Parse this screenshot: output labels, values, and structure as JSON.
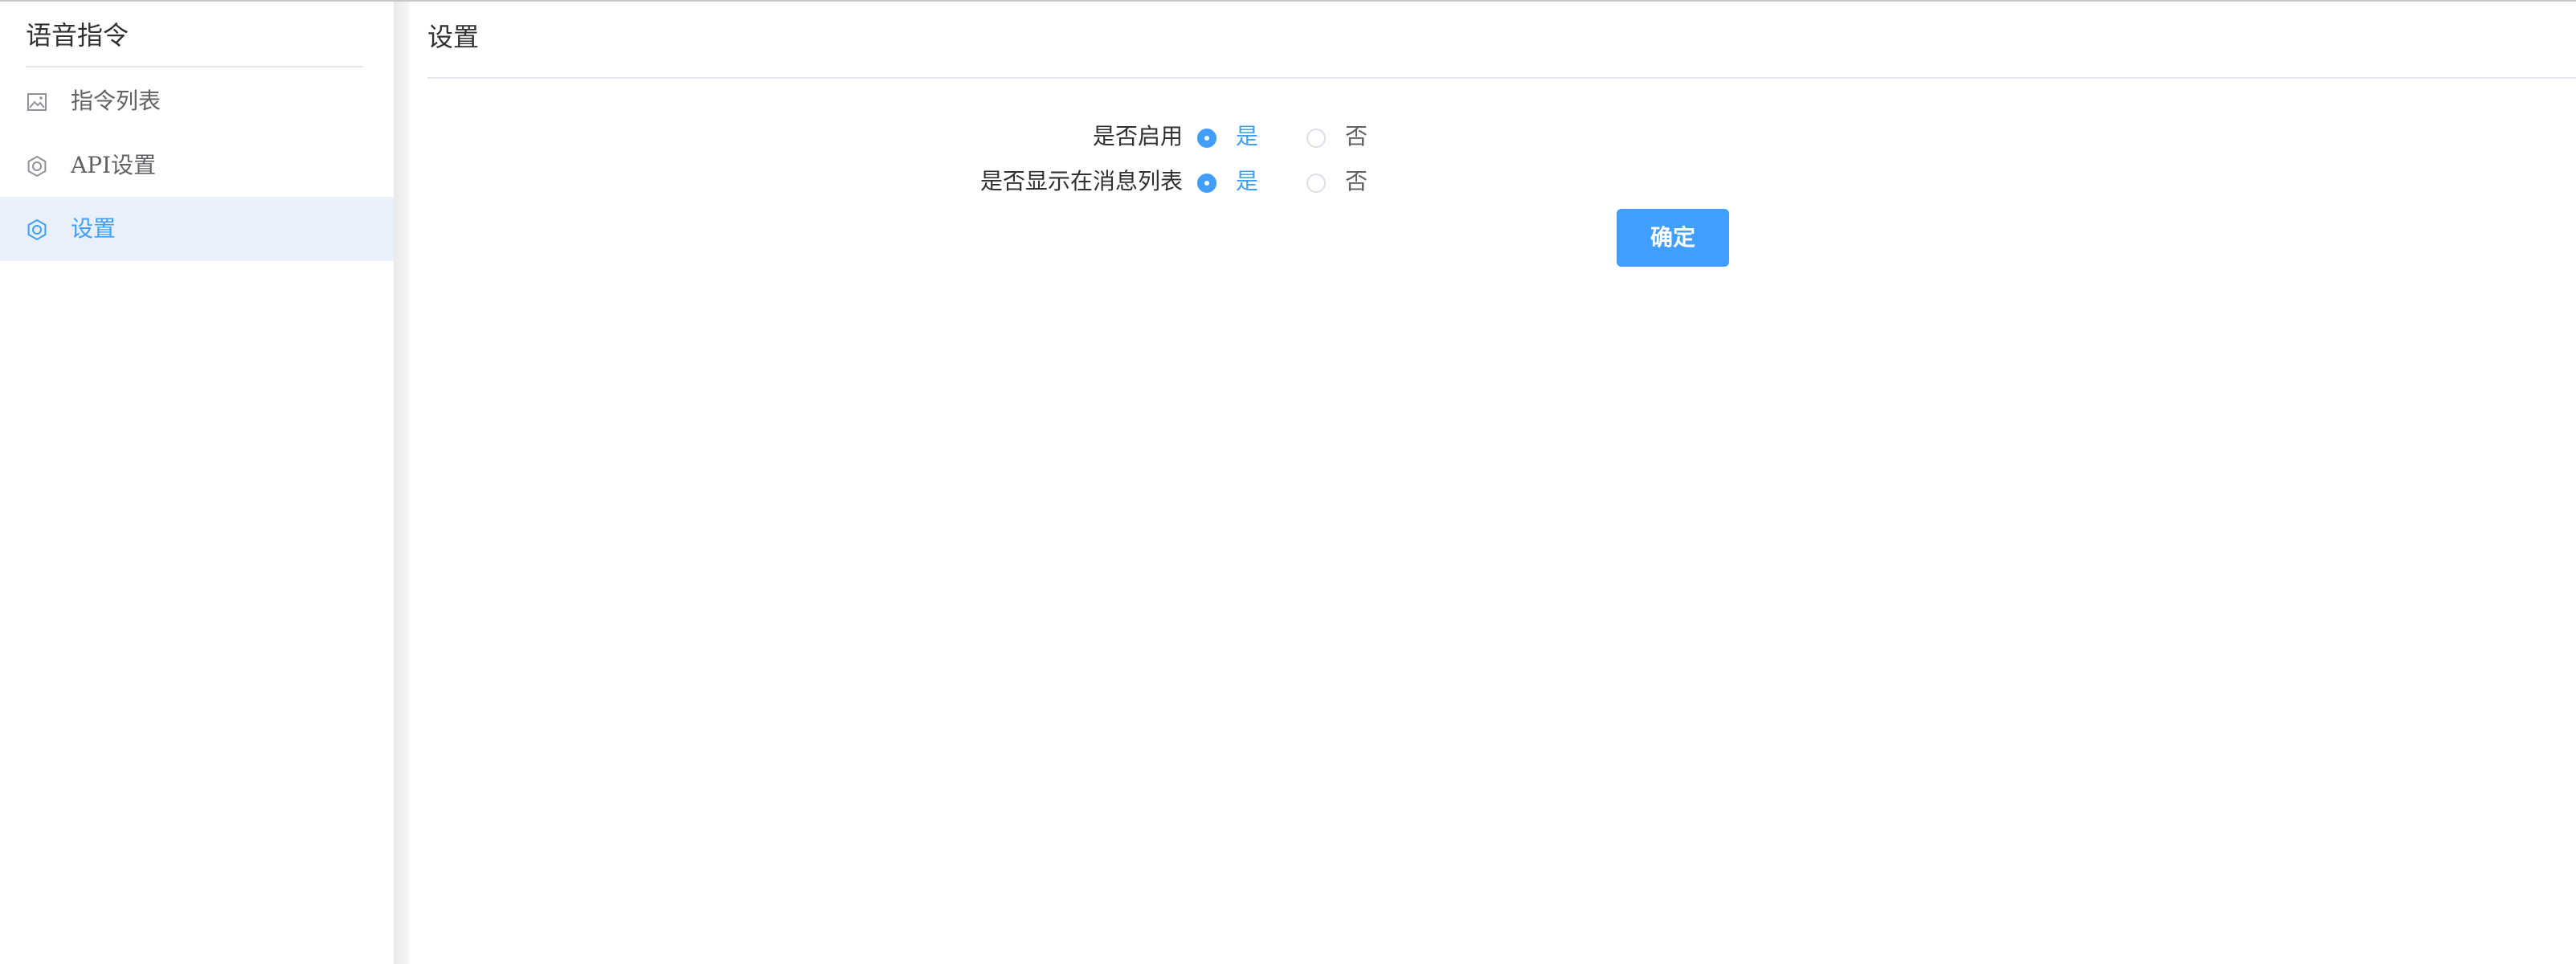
{
  "sidebar": {
    "title": "语音指令",
    "items": [
      {
        "label": "指令列表",
        "icon": "image-icon",
        "active": false
      },
      {
        "label": "API设置",
        "icon": "gear-icon",
        "active": false
      },
      {
        "label": "设置",
        "icon": "gear-icon",
        "active": true
      }
    ]
  },
  "main": {
    "title": "设置",
    "form": {
      "fields": [
        {
          "label": "是否启用",
          "options": [
            "是",
            "否"
          ],
          "selected": "是"
        },
        {
          "label": "是否显示在消息列表",
          "options": [
            "是",
            "否"
          ],
          "selected": "是"
        }
      ],
      "submit_label": "确定"
    }
  },
  "colors": {
    "accent": "#409eff",
    "active_bg": "#e8f1fb",
    "text_primary": "#303133",
    "text_secondary": "#606266"
  }
}
